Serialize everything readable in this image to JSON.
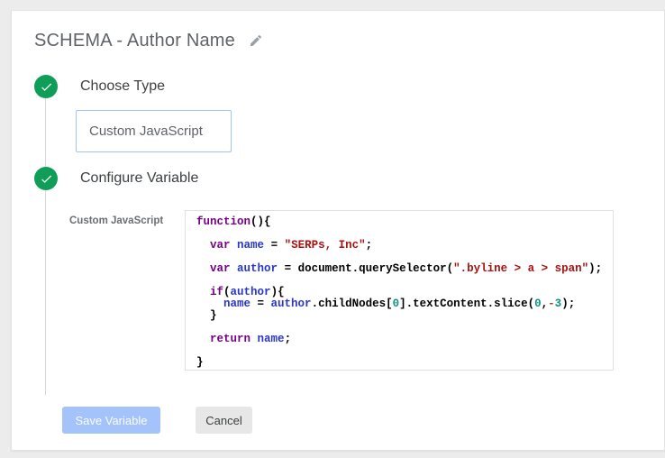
{
  "header": {
    "title": "SCHEMA - Author Name",
    "edit_icon": "pencil-icon"
  },
  "steps": [
    {
      "icon": "check-icon",
      "label": "Choose Type"
    },
    {
      "icon": "check-icon",
      "label": "Configure Variable"
    }
  ],
  "type_selector": {
    "value": "Custom JavaScript"
  },
  "editor": {
    "label": "Custom JavaScript",
    "language": "javascript",
    "lines": [
      [
        {
          "c": "kwd",
          "t": "function"
        },
        {
          "c": "pln",
          "t": "(){"
        }
      ],
      [],
      [
        {
          "c": "pln",
          "t": "  "
        },
        {
          "c": "kwd",
          "t": "var"
        },
        {
          "c": "pln",
          "t": " "
        },
        {
          "c": "vrb",
          "t": "name"
        },
        {
          "c": "pln",
          "t": " = "
        },
        {
          "c": "str",
          "t": "\"SERPs, Inc\""
        },
        {
          "c": "pln",
          "t": ";"
        }
      ],
      [],
      [
        {
          "c": "pln",
          "t": "  "
        },
        {
          "c": "kwd",
          "t": "var"
        },
        {
          "c": "pln",
          "t": " "
        },
        {
          "c": "vrb",
          "t": "author"
        },
        {
          "c": "pln",
          "t": " = document.querySelector("
        },
        {
          "c": "str",
          "t": "\".byline > a > span\""
        },
        {
          "c": "pln",
          "t": ");"
        }
      ],
      [],
      [
        {
          "c": "pln",
          "t": "  "
        },
        {
          "c": "kwd",
          "t": "if"
        },
        {
          "c": "pln",
          "t": "("
        },
        {
          "c": "vrb",
          "t": "author"
        },
        {
          "c": "pln",
          "t": "){"
        }
      ],
      [
        {
          "c": "pln",
          "t": "    "
        },
        {
          "c": "vrb",
          "t": "name"
        },
        {
          "c": "pln",
          "t": " = "
        },
        {
          "c": "vrb",
          "t": "author"
        },
        {
          "c": "pln",
          "t": ".childNodes["
        },
        {
          "c": "num",
          "t": "0"
        },
        {
          "c": "pln",
          "t": "].textContent.slice("
        },
        {
          "c": "num",
          "t": "0"
        },
        {
          "c": "pln",
          "t": ","
        },
        {
          "c": "op",
          "t": "-"
        },
        {
          "c": "num",
          "t": "3"
        },
        {
          "c": "pln",
          "t": ");"
        }
      ],
      [
        {
          "c": "pln",
          "t": "  }"
        }
      ],
      [],
      [
        {
          "c": "pln",
          "t": "  "
        },
        {
          "c": "kwd",
          "t": "return"
        },
        {
          "c": "pln",
          "t": " "
        },
        {
          "c": "vrb",
          "t": "name"
        },
        {
          "c": "pln",
          "t": ";"
        }
      ],
      [],
      [
        {
          "c": "pln",
          "t": "}"
        }
      ]
    ]
  },
  "footer": {
    "save_label": "Save Variable",
    "cancel_label": "Cancel"
  },
  "colors": {
    "page_background": "#ececec",
    "card_background": "#ffffff",
    "step_check_green": "#0f9d58",
    "type_box_border_blue": "#a4c2f8",
    "save_button_blue": "#a4c3fb",
    "cancel_button_gray": "#e7e7e7",
    "code_keyword": "#770088",
    "code_variable": "#2936c8",
    "code_string": "#aa1111",
    "code_number": "#0f9180",
    "code_operator": "#a3471d"
  }
}
